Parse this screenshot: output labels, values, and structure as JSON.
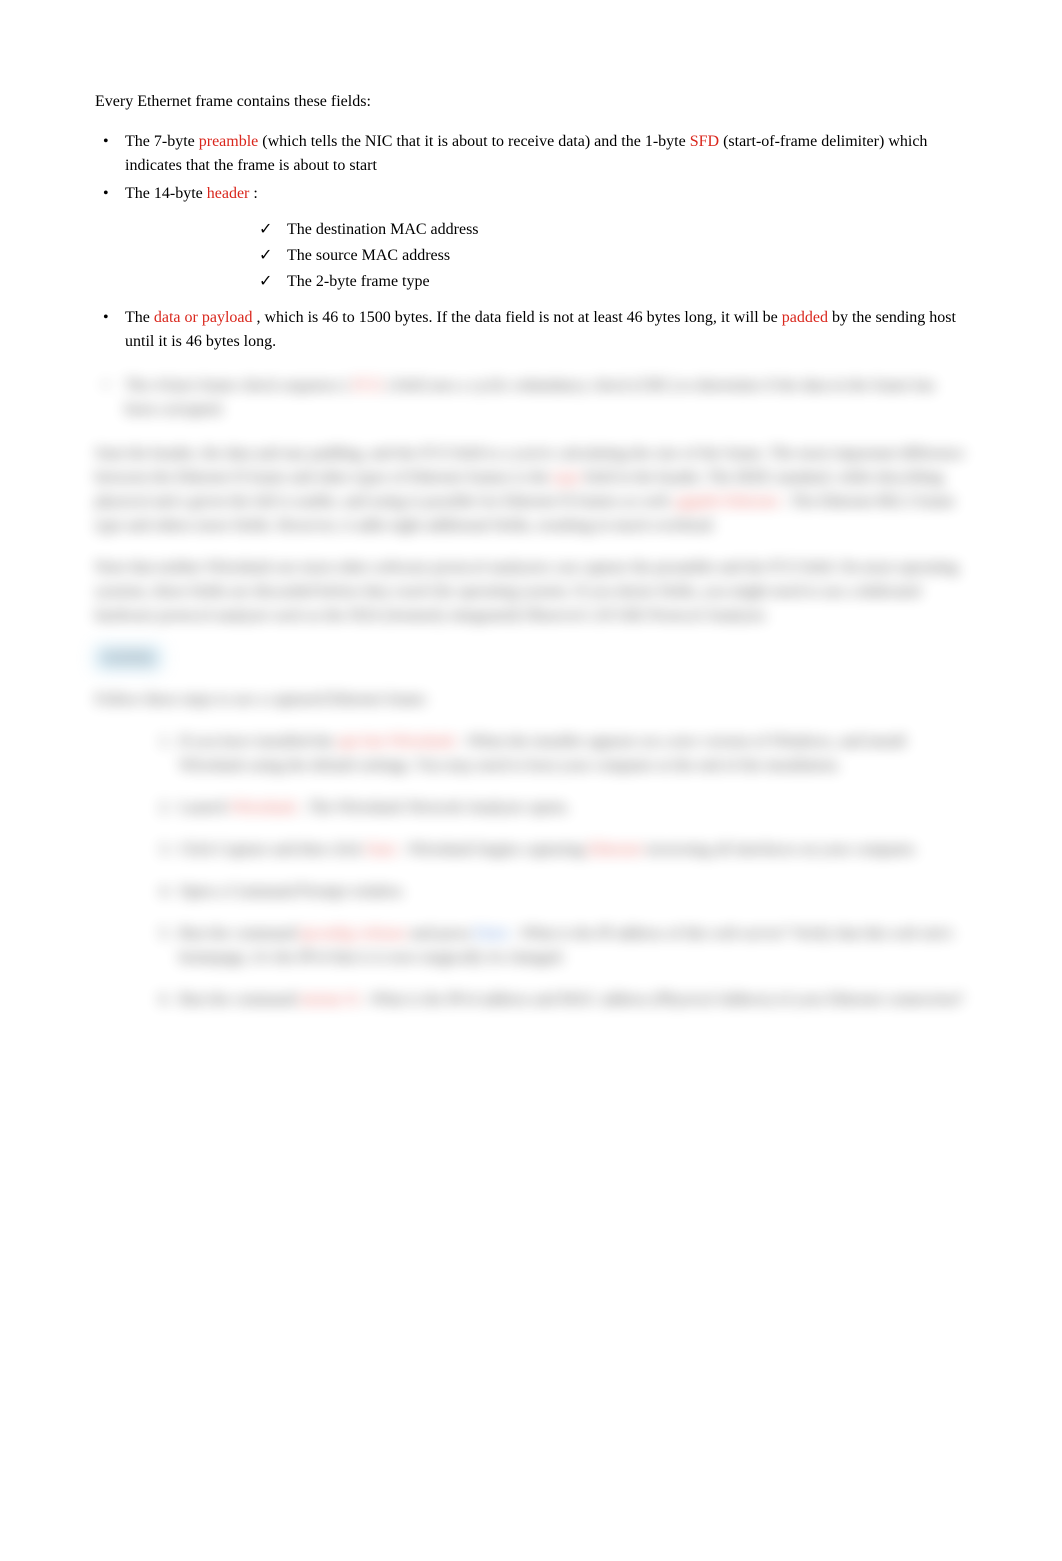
{
  "intro": "Every Ethernet frame contains these fields:",
  "bullets": {
    "b1_pre": "The 7-byte ",
    "b1_term1": "preamble",
    "b1_mid": " (which tells the NIC that it is about to receive data) and the 1-byte ",
    "b1_term2": "SFD",
    "b1_post": " (start-of-frame delimiter) which indicates that the frame is about to start",
    "b2_pre": "The 14-byte ",
    "b2_term": "header",
    "b2_post": " :",
    "sub1": "The destination MAC address",
    "sub2": "The source MAC address",
    "sub3": "The 2-byte frame type",
    "b3_pre": "The ",
    "b3_term1": "data or payload",
    "b3_mid": " , which is 46 to 1500 bytes. If the data field is not at least 46 bytes long, it will be ",
    "b3_term2": "padded",
    "b3_post": " by the sending host until it is 46 bytes long.",
    "b4_pre": "The 4-byte frame check sequence ( ",
    "b4_term": "FCS",
    "b4_post": " ) field uses a cyclic redundancy check (CRC) to determine if the data in the frame has been corrupted."
  },
  "para1": {
    "t1": "Sum the header, the data and any padding, and the FCS field to a you're calculating the size of the frame. The most important difference between the Ethernet II frame and other types of Ethernet frames is the ",
    "term1": "type",
    "t2": " field in the header. The IEEE standard, while describing physical and a given the full is usable, and using is possible for Ethernet II frames as well. ",
    "term2": "gigabit Ethernet",
    "t3": " . The Ethernet 802.3 frame type and others more fields. However, it adds eight additional fields, resulting in much overhead."
  },
  "para2": "Note that neither Wireshark nor most other software protocol analyzers can capture the preamble and the FCS field. On most operating systems, these fields are discarded before they reach the operating system. If you desire fields, you might need to use a dedicated hardware protocol analyzer such as the IXIA (formerly integrated) Observer's 20 GbE Protocol Analyzer.",
  "activity": "Activity",
  "activity_intro": "Follow these steps to see a captured Ethernet frame:",
  "steps": {
    "s1a": "If you have installed the ",
    "s1b": "apt-fast Wireshark",
    "s1c": " . When the installer appears on a new version of Windows, and install Wireshark using the default settings. You may need to boot your computer at the end of the installation.",
    "s2a": "Launch ",
    "s2b": "Wireshark",
    "s2c": " . The Wireshark Network Analyzer opens.",
    "s3a": "Click Capture and then click ",
    "s3b": "Start",
    "s3c": " . Wireshark begins capturing ",
    "s3d": "Ethernet",
    "s3e": " traversing all interfaces on your computer.",
    "s4": "Open a Command Prompt window.",
    "s5a": "Run the command ",
    "s5b": "ipconfig /release",
    "s5c": " and press ",
    "s5d": "Enter",
    "s5e": " . What is the IP address of this web server? Verify that this web site's homepage, it's the IPv4 that is is now magically its changed.",
    "s6a": "Run the command ",
    "s6b": "netstat /b",
    "s6c": " . What is the IPv4 address and MAC address (Physical Address) of your Ethernet connection?"
  }
}
